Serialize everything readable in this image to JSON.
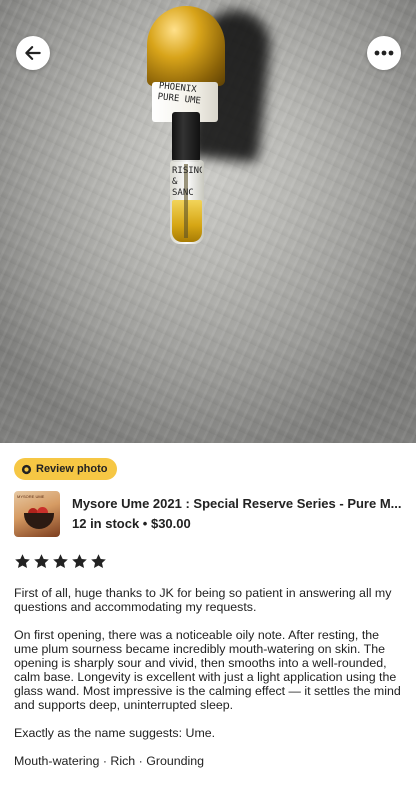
{
  "photo": {
    "bottle_label_lines": [
      "PHOENIX",
      "PURE UME"
    ],
    "vial_label_lines": [
      "RISING",
      "& SANC"
    ]
  },
  "header": {
    "back_icon": "arrow-left-icon",
    "more_icon": "more-horizontal-icon"
  },
  "review": {
    "badge_label": "Review photo",
    "badge_color": "#f6c744",
    "listing_title": "Mysore Ume 2021 : Special Reserve Series - Pure M...",
    "listing_meta": "12 in stock • $30.00",
    "thumbnail_caption": "MYSORE UME",
    "rating": 5,
    "rating_max": 5,
    "paragraphs": [
      "First of all, huge thanks to JK for being so patient in answering all my questions and accommodating my requests.",
      "On first opening, there was a noticeable oily note. After resting, the ume plum sourness became incredibly mouth-watering on skin. The opening is sharply sour and vivid, then smooths into a well-rounded, calm base. Longevity is excellent with just a light application using the glass wand. Most impressive is the calming effect — it settles the mind and supports deep, uninterrupted sleep.",
      "Exactly as the name suggests: Ume.",
      "Mouth-watering · Rich · Grounding"
    ]
  }
}
